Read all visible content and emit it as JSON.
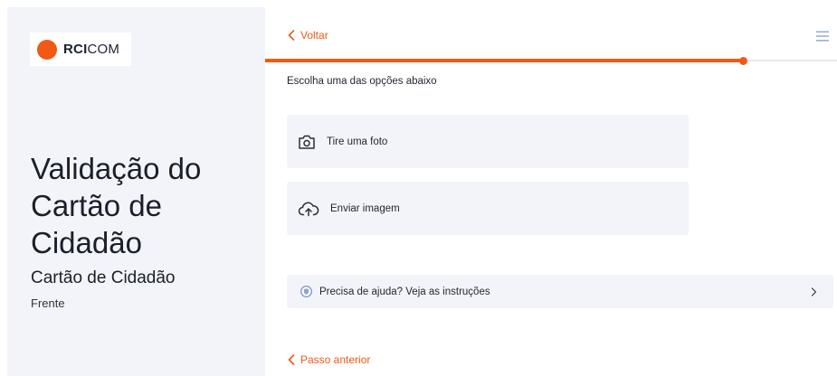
{
  "brand": {
    "logo_bold": "RCI",
    "logo_regular": "COM",
    "accent_color": "#f05a14"
  },
  "sidebar": {
    "title": "Validação do Cartão de Cidadão",
    "subtitle": "Cartão de Cidadão",
    "side_label": "Frente"
  },
  "header": {
    "back_label": "Voltar",
    "back_icon": "chevron-left-icon",
    "menu_icon": "hamburger-menu-icon"
  },
  "progress": {
    "value": 0.835
  },
  "main": {
    "instruction": "Escolha uma das opções abaixo",
    "options": [
      {
        "label": "Tire uma foto",
        "icon": "camera-icon"
      },
      {
        "label": "Enviar imagem",
        "icon": "cloud-upload-icon"
      }
    ],
    "help": {
      "label": "Precisa de ajuda? Veja as instruções",
      "icon": "help-shield-icon",
      "chevron_icon": "chevron-right-icon"
    },
    "previous_step_label": "Passo anterior"
  }
}
